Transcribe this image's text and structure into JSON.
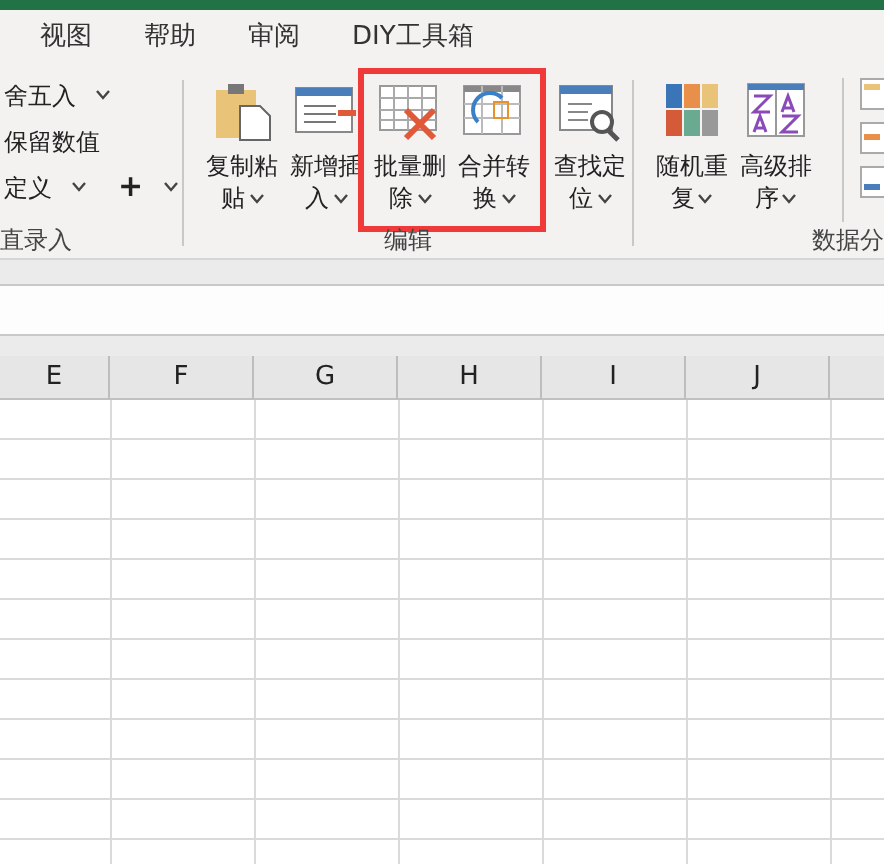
{
  "tabs": [
    {
      "label": "视图"
    },
    {
      "label": "帮助"
    },
    {
      "label": "审阅"
    },
    {
      "label": "DIY工具箱"
    }
  ],
  "ribbon": {
    "left_group": {
      "rows": [
        [
          {
            "label": "舍五入",
            "dropdown": true
          }
        ],
        [
          {
            "label": "保留数值",
            "dropdown": false
          }
        ],
        [
          {
            "label": "定义",
            "dropdown": true
          },
          {
            "label": "+",
            "dropdown": true
          }
        ]
      ],
      "label": "直录入"
    },
    "edit_group": {
      "label": "编辑",
      "buttons": [
        {
          "line1": "复制粘",
          "line2": "贴",
          "dropdown": true,
          "highlighted": false
        },
        {
          "line1": "新增插",
          "line2": "入",
          "dropdown": true,
          "highlighted": false
        },
        {
          "line1": "批量删",
          "line2": "除",
          "dropdown": true,
          "highlighted": true
        },
        {
          "line1": "合并转",
          "line2": "换",
          "dropdown": true,
          "highlighted": true
        },
        {
          "line1": "查找定",
          "line2": "位",
          "dropdown": true,
          "highlighted": false
        }
      ]
    },
    "data_group": {
      "label": "数据分",
      "buttons": [
        {
          "line1": "随机重",
          "line2": "复",
          "dropdown": true
        },
        {
          "line1": "高级排",
          "line2": "序",
          "dropdown": true
        }
      ]
    }
  },
  "sheet": {
    "columns": [
      "E",
      "F",
      "G",
      "H",
      "I",
      "J"
    ]
  }
}
